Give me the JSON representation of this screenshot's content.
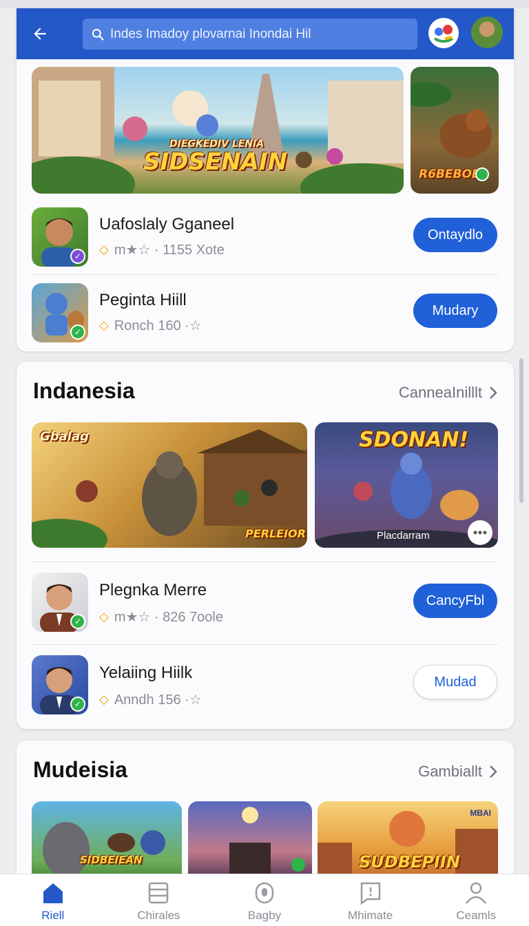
{
  "appbar": {
    "search_text": "Indes Imadoy plovarnai Inondai Hil"
  },
  "featured": {
    "banner_main_caption": "SIDSENAIN",
    "banner_main_subcaption": "DIEGKEDIV LENIA",
    "banner_side_caption": "R6BEBOB"
  },
  "list1": [
    {
      "title": "Uafoslaly Gganeel",
      "meta": "m★☆ · 1155 Xote",
      "button": "Ontaydlo"
    },
    {
      "title": "Peginta Hiill",
      "meta": "Ronch 160 ·☆",
      "button": "Mudary"
    }
  ],
  "section2": {
    "title": "Indanesia",
    "link": "CanneaInilllt",
    "banner_left_caption": "Gbalag",
    "banner_left_tag": "PERLEIOR",
    "banner_right_caption": "SDONAN!",
    "banner_right_label": "Placdarram",
    "items": [
      {
        "title": "Plegnka Merre",
        "meta": "m★☆ · 826 7oole",
        "button": "CancyFbl"
      },
      {
        "title": "Yelaiing Hiilk",
        "meta": "Anndh 156 ·☆",
        "button": "Mudad"
      }
    ]
  },
  "section3": {
    "title": "Mudeisia",
    "link": "Gambiallt",
    "banner1_caption": "SIDBEIEAN",
    "banner3_caption": "SUDBEPIIN",
    "banner3_tag": "MBAI"
  },
  "nav": [
    {
      "label": "Riell"
    },
    {
      "label": "Chirales"
    },
    {
      "label": "Bagby"
    },
    {
      "label": "Mhimate"
    },
    {
      "label": "Ceamls"
    }
  ],
  "colors": {
    "accent": "#2458c8",
    "button": "#2060d8"
  }
}
